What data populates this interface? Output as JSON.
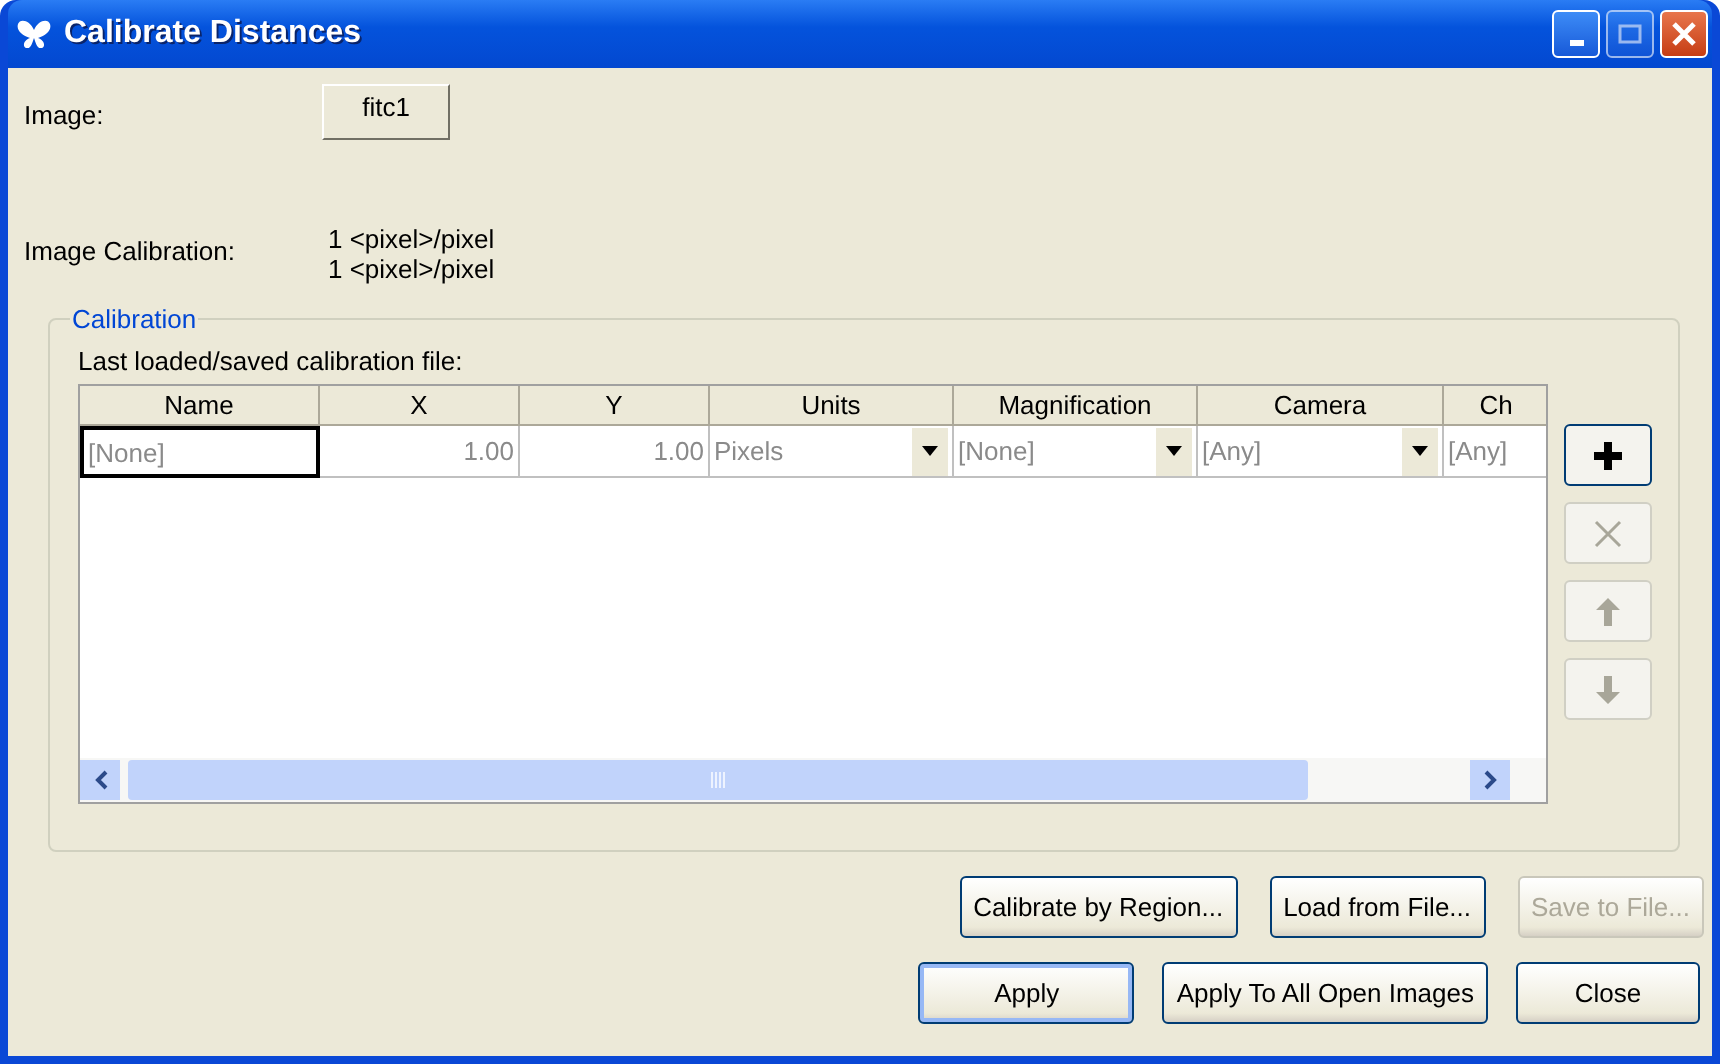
{
  "window": {
    "title": "Calibrate Distances"
  },
  "image": {
    "label": "Image:",
    "button": "fitc1"
  },
  "image_calibration": {
    "label": "Image Calibration:",
    "values": [
      "1 <pixel>/pixel",
      "1 <pixel>/pixel"
    ]
  },
  "calibration": {
    "legend": "Calibration",
    "file_label": "Last loaded/saved calibration file:",
    "columns": [
      "Name",
      "X",
      "Y",
      "Units",
      "Magnification",
      "Camera",
      "Ch"
    ],
    "rows": [
      {
        "cells": [
          {
            "kind": "text",
            "value": "[None]",
            "focused": true
          },
          {
            "kind": "number",
            "value": "1.00"
          },
          {
            "kind": "number",
            "value": "1.00"
          },
          {
            "kind": "dropdown",
            "value": "Pixels"
          },
          {
            "kind": "dropdown",
            "value": "[None]"
          },
          {
            "kind": "dropdown",
            "value": "[Any]"
          },
          {
            "kind": "text",
            "value": "[Any]"
          }
        ]
      }
    ],
    "side_buttons": [
      {
        "kind": "add",
        "disabled": false
      },
      {
        "kind": "delete",
        "disabled": true
      },
      {
        "kind": "up",
        "disabled": true
      },
      {
        "kind": "down",
        "disabled": true
      }
    ]
  },
  "file_buttons": [
    {
      "label": "Calibrate by Region...",
      "disabled": false
    },
    {
      "label": "Load from File...",
      "disabled": false
    },
    {
      "label": "Save to File...",
      "disabled": true
    }
  ],
  "dialog_buttons": [
    {
      "label": "Apply",
      "default": true
    },
    {
      "label": "Apply To All Open Images",
      "default": false
    },
    {
      "label": "Close",
      "default": false
    }
  ]
}
